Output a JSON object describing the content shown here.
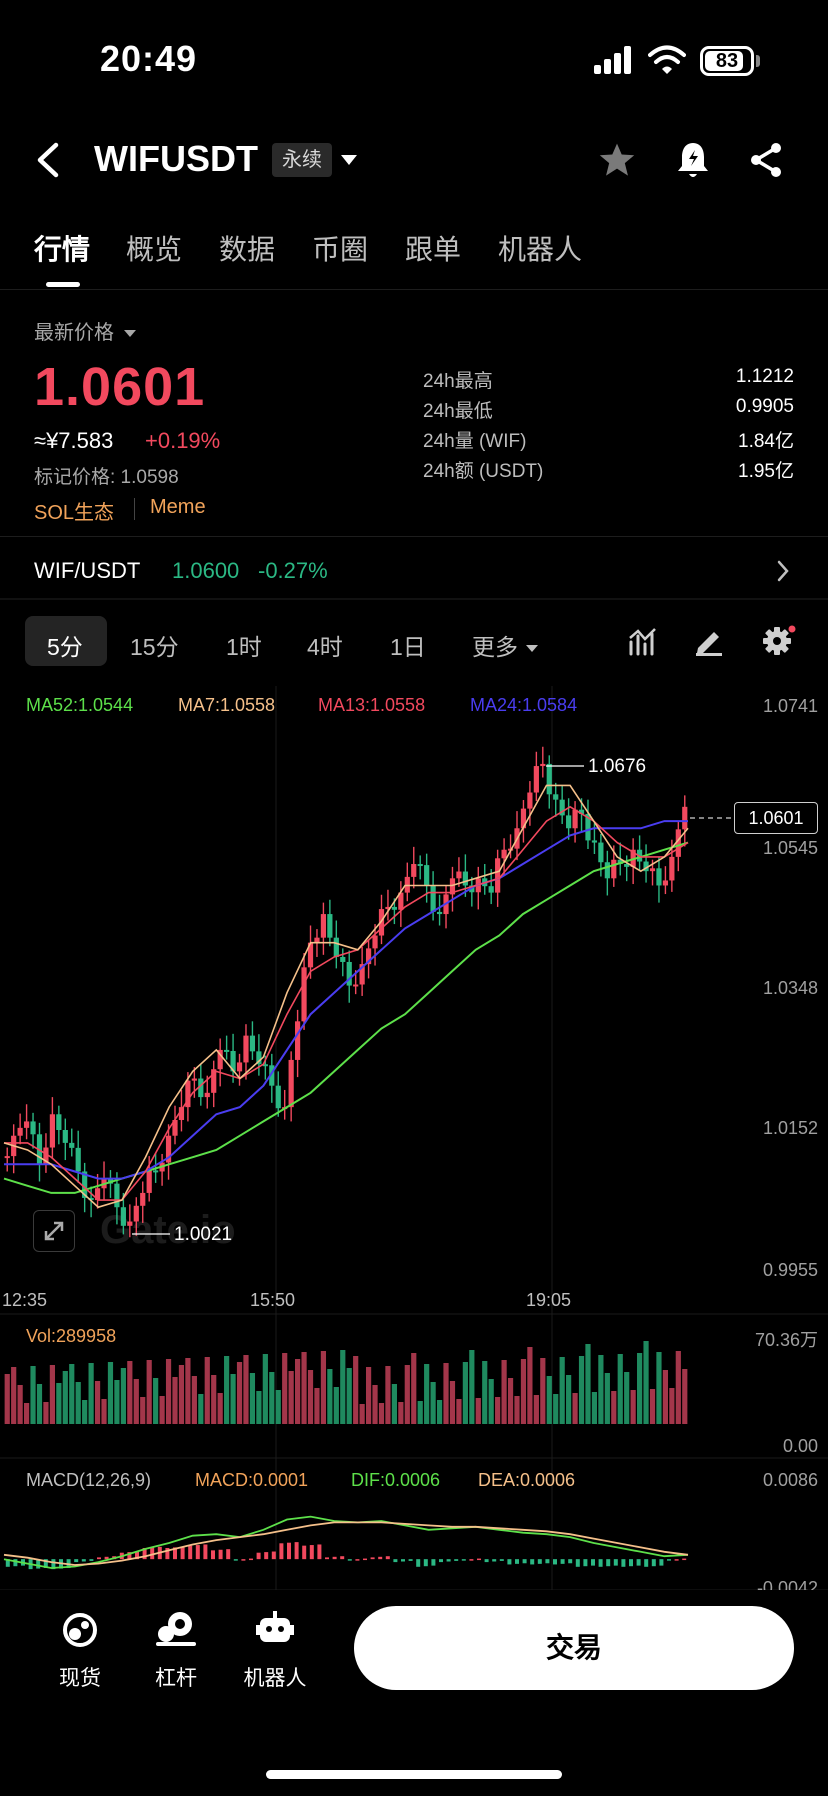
{
  "status_bar": {
    "time": "20:49",
    "battery": "83"
  },
  "header": {
    "title": "WIFUSDT",
    "badge": "永续"
  },
  "tabs": [
    {
      "label": "行情"
    },
    {
      "label": "概览"
    },
    {
      "label": "数据"
    },
    {
      "label": "币圈"
    },
    {
      "label": "跟单"
    },
    {
      "label": "机器人"
    }
  ],
  "price": {
    "label": "最新价格",
    "last": "1.0601",
    "cny": "≈¥7.583",
    "change": "+0.19%",
    "mark": "标记价格: 1.0598",
    "tags": [
      "SOL生态",
      "Meme"
    ]
  },
  "stats": [
    {
      "label": "24h最高",
      "value": "1.1212"
    },
    {
      "label": "24h最低",
      "value": "0.9905"
    },
    {
      "label": "24h量 (WIF)",
      "value": "1.84亿"
    },
    {
      "label": "24h额 (USDT)",
      "value": "1.95亿"
    }
  ],
  "spot": {
    "pair": "WIF/USDT",
    "price": "1.0600",
    "change": "-0.27%"
  },
  "intervals": [
    {
      "label": "5分"
    },
    {
      "label": "15分"
    },
    {
      "label": "1时"
    },
    {
      "label": "4时"
    },
    {
      "label": "1日"
    },
    {
      "label": "更多"
    }
  ],
  "colors": {
    "up": "#f2495e",
    "down": "#2bb884",
    "ma52": "#5de04a",
    "ma7": "#f5c08a",
    "ma13": "#f2495e",
    "ma24": "#4a3df0",
    "vol": "#f1a35a"
  },
  "ma_labels": {
    "ma52": "MA52:1.0544",
    "ma7": "MA7:1.0558",
    "ma13": "MA13:1.0558",
    "ma24": "MA24:1.0584"
  },
  "macd_labels": {
    "title": "MACD(12,26,9)",
    "macd": "MACD:0.0001",
    "dif": "DIF:0.0006",
    "dea": "DEA:0.0006"
  },
  "volume_labels": {
    "vol": "Vol:289958",
    "max": "70.36万",
    "min": "0.00"
  },
  "macd_axis": {
    "top": "0.0086",
    "bottom": "-0.0042"
  },
  "chart_data": {
    "type": "candlestick",
    "price_axis": [
      1.0741,
      1.0545,
      1.0348,
      1.0152,
      0.9955
    ],
    "time_axis": [
      "12:35",
      "15:50",
      "19:05"
    ],
    "ylim": [
      0.9955,
      1.0741
    ],
    "high_marker": "1.0676",
    "low_marker": "1.0021",
    "last_price_box": "1.0601",
    "close_path": [
      1.014,
      1.016,
      1.01,
      1.017,
      1.013,
      1.009,
      1.005,
      1.008,
      1.004,
      1.002,
      1.006,
      1.009,
      1.014,
      1.018,
      1.022,
      1.02,
      1.026,
      1.023,
      1.028,
      1.024,
      1.021,
      1.018,
      1.03,
      1.041,
      1.045,
      1.039,
      1.035,
      1.038,
      1.042,
      1.046,
      1.048,
      1.052,
      1.049,
      1.045,
      1.05,
      1.049,
      1.05,
      1.048,
      1.054,
      1.057,
      1.062,
      1.066,
      1.061,
      1.057,
      1.059,
      1.055,
      1.05,
      1.052,
      1.054,
      1.051,
      1.049,
      1.053,
      1.06
    ],
    "ma52": [
      1.008,
      1.007,
      1.006,
      1.006,
      1.007,
      1.008,
      1.009,
      1.01,
      1.011,
      1.012,
      1.014,
      1.016,
      1.018,
      1.02,
      1.023,
      1.026,
      1.029,
      1.031,
      1.034,
      1.037,
      1.04,
      1.042,
      1.045,
      1.047,
      1.049,
      1.051,
      1.052,
      1.053,
      1.054,
      1.055
    ],
    "ma7": [
      1.013,
      1.012,
      1.01,
      1.007,
      1.004,
      1.005,
      1.011,
      1.018,
      1.023,
      1.026,
      1.022,
      1.025,
      1.034,
      1.041,
      1.041,
      1.04,
      1.044,
      1.049,
      1.049,
      1.049,
      1.05,
      1.051,
      1.057,
      1.063,
      1.063,
      1.058,
      1.053,
      1.051,
      1.053,
      1.057
    ],
    "ma13": [
      1.013,
      1.013,
      1.011,
      1.008,
      1.005,
      1.005,
      1.009,
      1.015,
      1.02,
      1.023,
      1.022,
      1.024,
      1.031,
      1.037,
      1.039,
      1.04,
      1.043,
      1.046,
      1.048,
      1.048,
      1.049,
      1.05,
      1.054,
      1.058,
      1.06,
      1.058,
      1.055,
      1.053,
      1.053,
      1.055
    ],
    "ma24": [
      1.01,
      1.01,
      1.01,
      1.009,
      1.008,
      1.008,
      1.009,
      1.011,
      1.014,
      1.017,
      1.018,
      1.021,
      1.026,
      1.031,
      1.034,
      1.037,
      1.04,
      1.043,
      1.045,
      1.047,
      1.049,
      1.05,
      1.052,
      1.054,
      1.056,
      1.057,
      1.057,
      1.057,
      1.058,
      1.058
    ],
    "macd_dif": [
      0.0,
      -0.0006,
      -0.0012,
      -0.001,
      -0.0004,
      0.0004,
      0.0014,
      0.0022,
      0.0032,
      0.0034,
      0.003,
      0.004,
      0.0054,
      0.0058,
      0.0052,
      0.005,
      0.0052,
      0.0046,
      0.004,
      0.0042,
      0.0044,
      0.004,
      0.0036,
      0.0034,
      0.003,
      0.0022,
      0.0016,
      0.001,
      0.0004,
      0.0006
    ],
    "macd_dea": [
      0.0006,
      0.0002,
      -0.0004,
      -0.0008,
      -0.0006,
      -0.0002,
      0.0004,
      0.0012,
      0.002,
      0.0026,
      0.003,
      0.0034,
      0.004,
      0.0046,
      0.005,
      0.005,
      0.005,
      0.0048,
      0.0046,
      0.0044,
      0.0044,
      0.0042,
      0.004,
      0.0038,
      0.0034,
      0.0028,
      0.0022,
      0.0016,
      0.001,
      0.0006
    ]
  },
  "bottom_nav": [
    {
      "label": "现货"
    },
    {
      "label": "杠杆"
    },
    {
      "label": "机器人"
    }
  ],
  "trade_button": "交易"
}
